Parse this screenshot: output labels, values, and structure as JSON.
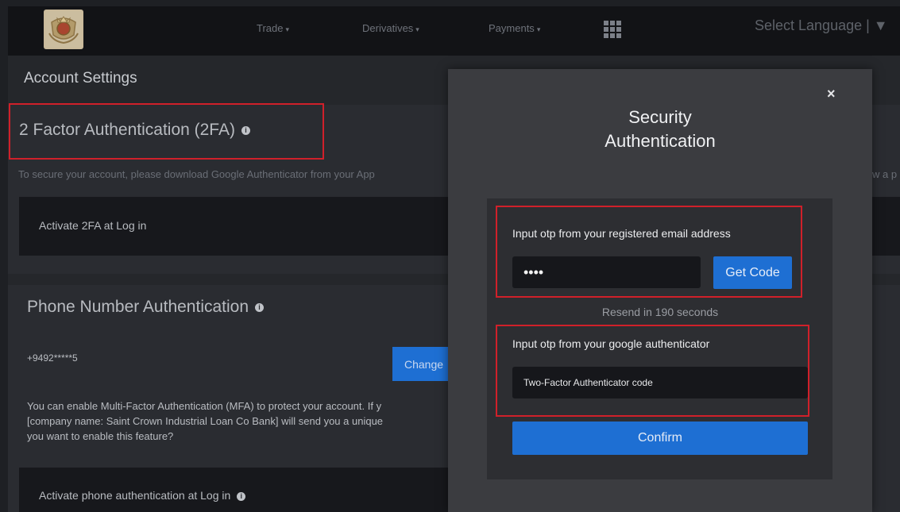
{
  "nav": {
    "items": [
      {
        "label": "Trade",
        "caret": "▾"
      },
      {
        "label": "Derivatives",
        "caret": "▾"
      },
      {
        "label": "Payments",
        "caret": "▾"
      }
    ],
    "language": "Select Language | ▼"
  },
  "page": {
    "title": "Account Settings",
    "twofa": {
      "title": "2 Factor Authentication (2FA)",
      "description": "To secure your account, please download Google Authenticator from your App",
      "description_tail": "w a p",
      "activate_label": "Activate 2FA at Log in"
    },
    "phone": {
      "title": "Phone Number Authentication",
      "number": "+9492*****5",
      "change_label": "Change",
      "mfa_lines": [
        "You can enable Multi-Factor Authentication (MFA) to protect your account. If y",
        "[company name: Saint Crown Industrial Loan Co Bank] will send you a unique",
        "you want to enable this feature?"
      ],
      "activate_label": "Activate phone authentication at Log in"
    }
  },
  "modal": {
    "close": "×",
    "title_line1": "Security",
    "title_line2": "Authentication",
    "email_label": "Input otp from your registered email address",
    "email_value": "••••",
    "get_code_label": "Get Code",
    "resend_text": "Resend in 190 seconds",
    "google_label": "Input otp from your google authenticator",
    "google_placeholder": "Two-Factor Authenticator code",
    "confirm_label": "Confirm"
  },
  "colors": {
    "accent": "#1e6fd3",
    "highlight_border": "#d0202a"
  },
  "icons": [
    "crest-logo-icon",
    "apps-grid-icon",
    "info-icon",
    "close-icon"
  ]
}
